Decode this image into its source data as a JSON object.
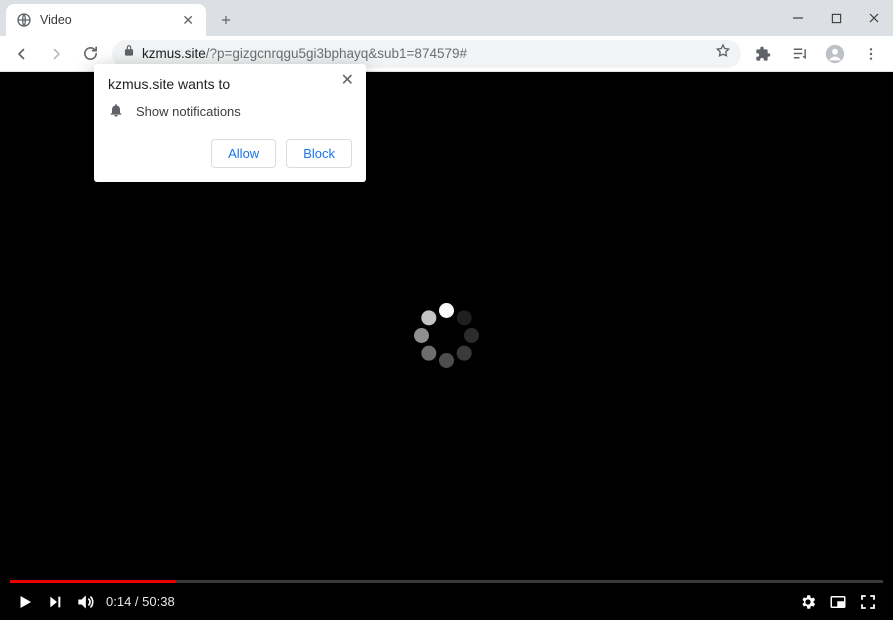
{
  "window": {
    "minimize": "minimize",
    "maximize": "maximize",
    "close": "close"
  },
  "tab": {
    "title": "Video"
  },
  "url": {
    "host": "kzmus.site",
    "rest": "/?p=gizgcnrqgu5gi3bphayq&sub1=874579#"
  },
  "notification": {
    "origin_wants": "kzmus.site wants to",
    "prompt": "Show notifications",
    "allow": "Allow",
    "block": "Block"
  },
  "video": {
    "current_time": "0:14",
    "separator": " / ",
    "duration": "50:38",
    "progress_percent": 19
  },
  "spinner_dots": [
    {
      "angle": 270,
      "color": "#fafafa"
    },
    {
      "angle": 315,
      "color": "#1f1f1f"
    },
    {
      "angle": 0,
      "color": "#2c2c2c"
    },
    {
      "angle": 45,
      "color": "#3a3a3a"
    },
    {
      "angle": 90,
      "color": "#4d4d4d"
    },
    {
      "angle": 135,
      "color": "#6d6d6d"
    },
    {
      "angle": 180,
      "color": "#8f8f8f"
    },
    {
      "angle": 225,
      "color": "#c4c4c4"
    }
  ]
}
